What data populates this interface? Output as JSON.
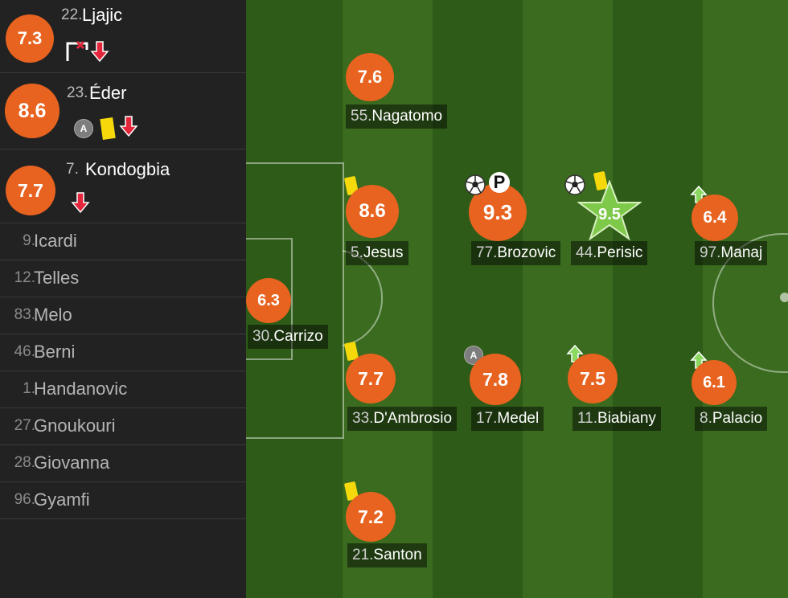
{
  "substitutes_out": [
    {
      "rating": "7.3",
      "number": "22.",
      "name": "Ljajic",
      "events": [
        "missed-penalty-icon",
        "sub-off-arrow-icon"
      ]
    },
    {
      "rating": "8.6",
      "number": "23.",
      "name": "Éder",
      "events": [
        "assist-icon",
        "yellow-card-icon",
        "sub-off-arrow-icon"
      ]
    },
    {
      "rating": "7.7",
      "number": "7.",
      "name": "Kondogbia",
      "events": [
        "sub-off-arrow-icon"
      ]
    }
  ],
  "bench": [
    {
      "number": "9.",
      "name": "Icardi"
    },
    {
      "number": "12.",
      "name": "Telles"
    },
    {
      "number": "83.",
      "name": "Melo"
    },
    {
      "number": "46.",
      "name": "Berni"
    },
    {
      "number": "1.",
      "name": "Handanovic"
    },
    {
      "number": "27.",
      "name": "Gnoukouri"
    },
    {
      "number": "28.",
      "name": "Giovanna"
    },
    {
      "number": "96.",
      "name": "Gyamfi"
    }
  ],
  "assist_letter": "A",
  "penalty_letter": "P",
  "players": [
    {
      "id": "nagatomo",
      "rating": "7.6",
      "number": "55.",
      "name": "Nagatomo",
      "events": []
    },
    {
      "id": "jesus",
      "rating": "8.6",
      "number": "5.",
      "name": "Jesus",
      "events": [
        "yellow-card"
      ]
    },
    {
      "id": "brozovic",
      "rating": "9.3",
      "number": "77.",
      "name": "Brozovic",
      "events": [
        "goal",
        "penalty-goal"
      ]
    },
    {
      "id": "perisic",
      "rating": "9.5",
      "number": "44.",
      "name": "Perisic",
      "events": [
        "goal",
        "yellow-card"
      ],
      "man_of_the_match": true
    },
    {
      "id": "manaj",
      "rating": "6.4",
      "number": "97.",
      "name": "Manaj",
      "events": [
        "sub-on"
      ]
    },
    {
      "id": "carrizo",
      "rating": "6.3",
      "number": "30.",
      "name": "Carrizo",
      "events": []
    },
    {
      "id": "dambrosio",
      "rating": "7.7",
      "number": "33.",
      "name": "D'Ambrosio",
      "events": [
        "yellow-card"
      ]
    },
    {
      "id": "medel",
      "rating": "7.8",
      "number": "17.",
      "name": "Medel",
      "events": [
        "assist"
      ]
    },
    {
      "id": "biabiany",
      "rating": "7.5",
      "number": "11.",
      "name": "Biabiany",
      "events": [
        "sub-on"
      ]
    },
    {
      "id": "palacio",
      "rating": "6.1",
      "number": "8.",
      "name": "Palacio",
      "events": [
        "sub-on"
      ]
    },
    {
      "id": "santon",
      "rating": "7.2",
      "number": "21.",
      "name": "Santon",
      "events": [
        "yellow-card"
      ]
    }
  ],
  "colors": {
    "rating": "#e7631f",
    "motm_star": "#7ec84a",
    "yellow_card": "#f5d90a",
    "sub_off": "#e3263b",
    "sub_on": "#8bd860",
    "pitch_dark": "#2f5a17",
    "pitch_light": "#3a6a1d"
  }
}
